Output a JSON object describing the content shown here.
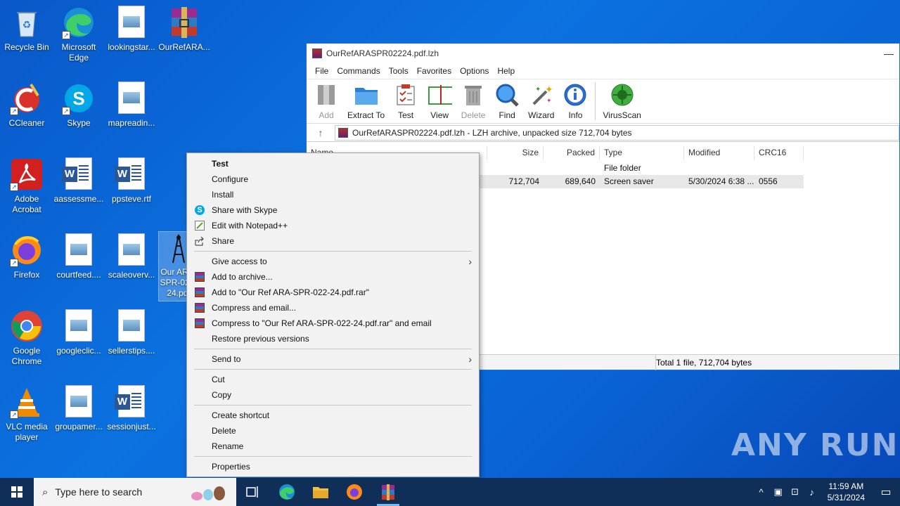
{
  "desktop_icons": [
    {
      "label": "Recycle Bin",
      "icon": "recycle-bin-icon"
    },
    {
      "label": "Microsoft Edge",
      "icon": "edge-icon"
    },
    {
      "label": "lookingstar...",
      "icon": "image-file-icon"
    },
    {
      "label": "OurRefARA...",
      "icon": "winrar-icon"
    },
    {
      "label": "CCleaner",
      "icon": "ccleaner-icon"
    },
    {
      "label": "Skype",
      "icon": "skype-icon"
    },
    {
      "label": "mapreadin...",
      "icon": "image-file-icon"
    },
    {
      "label": "Adobe Acrobat",
      "icon": "acrobat-icon"
    },
    {
      "label": "aassessme...",
      "icon": "word-doc-icon"
    },
    {
      "label": "ppsteve.rtf",
      "icon": "word-doc-icon"
    },
    {
      "label": "Firefox",
      "icon": "firefox-icon"
    },
    {
      "label": "courtfeed....",
      "icon": "image-file-icon"
    },
    {
      "label": "scaleoverv...",
      "icon": "image-file-icon"
    },
    {
      "label": "Our ARA-SPR-022-24.pdf",
      "icon": "screensaver-file-icon"
    },
    {
      "label": "Google Chrome",
      "icon": "chrome-icon"
    },
    {
      "label": "googleclic...",
      "icon": "image-file-icon"
    },
    {
      "label": "sellerstips....",
      "icon": "image-file-icon"
    },
    {
      "label": "VLC media player",
      "icon": "vlc-icon"
    },
    {
      "label": "groupamer...",
      "icon": "image-file-icon"
    },
    {
      "label": "sessionjust...",
      "icon": "word-doc-icon"
    }
  ],
  "window": {
    "title": "OurRefARASPR02224.pdf.lzh",
    "menu": [
      "File",
      "Commands",
      "Tools",
      "Favorites",
      "Options",
      "Help"
    ],
    "toolbar": [
      {
        "label": "Add",
        "icon": "add-archive-icon",
        "disabled": true
      },
      {
        "label": "Extract To",
        "icon": "extract-folder-icon",
        "disabled": false
      },
      {
        "label": "Test",
        "icon": "test-checklist-icon",
        "disabled": false
      },
      {
        "label": "View",
        "icon": "view-book-icon",
        "disabled": false
      },
      {
        "label": "Delete",
        "icon": "trash-icon",
        "disabled": true
      },
      {
        "label": "Find",
        "icon": "magnifier-icon",
        "disabled": false
      },
      {
        "label": "Wizard",
        "icon": "wand-icon",
        "disabled": false
      },
      {
        "label": "Info",
        "icon": "info-icon",
        "disabled": false
      },
      {
        "label": "VirusScan",
        "icon": "virus-icon",
        "disabled": false
      }
    ],
    "address": "OurRefARASPR02224.pdf.lzh - LZH archive, unpacked size 712,704 bytes",
    "columns": {
      "name": "Name",
      "size": "Size",
      "packed": "Packed",
      "type": "Type",
      "modified": "Modified",
      "crc": "CRC16"
    },
    "rows": [
      {
        "size": "",
        "packed": "",
        "type": "File folder",
        "modified": "",
        "crc": ""
      },
      {
        "size": "712,704",
        "packed": "689,640",
        "type": "Screen saver",
        "modified": "5/30/2024 6:38 ...",
        "crc": "0556"
      }
    ],
    "status": "Total 1 file, 712,704 bytes"
  },
  "context_menu": {
    "items": [
      {
        "label": "Test",
        "bold": true,
        "icon": ""
      },
      {
        "label": "Configure",
        "icon": ""
      },
      {
        "label": "Install",
        "icon": ""
      },
      {
        "label": "Share with Skype",
        "icon": "skype-icon"
      },
      {
        "label": "Edit with Notepad++",
        "icon": "notepadpp-icon"
      },
      {
        "label": "Share",
        "icon": "share-icon"
      },
      {
        "sep": true
      },
      {
        "label": "Give access to",
        "submenu": true
      },
      {
        "label": "Add to archive...",
        "icon": "winrar-icon"
      },
      {
        "label": "Add to \"Our Ref ARA-SPR-022-24.pdf.rar\"",
        "icon": "winrar-icon"
      },
      {
        "label": "Compress and email...",
        "icon": "winrar-icon"
      },
      {
        "label": "Compress to \"Our Ref ARA-SPR-022-24.pdf.rar\" and email",
        "icon": "winrar-icon"
      },
      {
        "label": "Restore previous versions"
      },
      {
        "sep": true
      },
      {
        "label": "Send to",
        "submenu": true
      },
      {
        "sep": true
      },
      {
        "label": "Cut"
      },
      {
        "label": "Copy"
      },
      {
        "sep": true
      },
      {
        "label": "Create shortcut"
      },
      {
        "label": "Delete"
      },
      {
        "label": "Rename"
      },
      {
        "sep": true
      },
      {
        "label": "Properties"
      }
    ]
  },
  "taskbar": {
    "search_placeholder": "Type here to search",
    "time": "11:59 AM",
    "date": "5/31/2024"
  },
  "watermark": "ANY RUN"
}
